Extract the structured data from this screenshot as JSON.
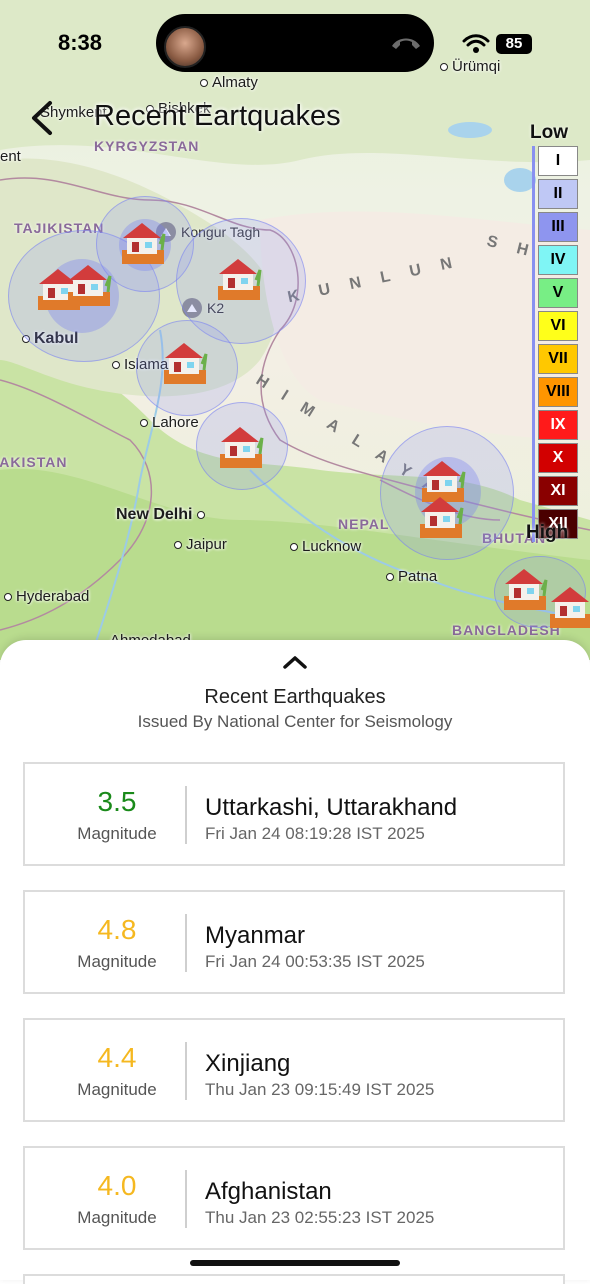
{
  "status_bar": {
    "time": "8:38",
    "battery": "85"
  },
  "header": {
    "title": "Recent Eartquakes"
  },
  "map": {
    "cities": [
      "Almaty",
      "Shymkent",
      "Bishkek",
      "Ürümqi",
      "Kabul",
      "Islamabad",
      "Lahore",
      "New Delhi",
      "Jaipur",
      "Lucknow",
      "Hyderabad",
      "Patna",
      "Ahmedabad"
    ],
    "countries": [
      "KYRGYZSTAN",
      "TAJIKISTAN",
      "PAKISTAN",
      "NEPAL",
      "BHUTAN",
      "BANGLADESH"
    ],
    "peaks": [
      "Kongur Tagh",
      "K2"
    ],
    "ranges": [
      "KUNLUN",
      "HIMALAYA"
    ],
    "partial_labels": [
      "ent",
      "SH"
    ]
  },
  "legend": {
    "low_label": "Low",
    "high_label": "High",
    "levels": [
      {
        "label": "I",
        "color": "#ffffff",
        "text": "#000000"
      },
      {
        "label": "II",
        "color": "#bfc8f5",
        "text": "#000000"
      },
      {
        "label": "III",
        "color": "#8e95ef",
        "text": "#000000"
      },
      {
        "label": "IV",
        "color": "#7ff5f5",
        "text": "#000000"
      },
      {
        "label": "V",
        "color": "#78ee85",
        "text": "#000000"
      },
      {
        "label": "VI",
        "color": "#ffff1a",
        "text": "#000000"
      },
      {
        "label": "VII",
        "color": "#ffc800",
        "text": "#000000"
      },
      {
        "label": "VIII",
        "color": "#ff9500",
        "text": "#000000"
      },
      {
        "label": "IX",
        "color": "#ff1a1a",
        "text": "#ffffff"
      },
      {
        "label": "X",
        "color": "#d20000",
        "text": "#ffffff"
      },
      {
        "label": "XI",
        "color": "#8a0000",
        "text": "#ffffff"
      },
      {
        "label": "XII",
        "color": "#4a0000",
        "text": "#ffffff"
      }
    ]
  },
  "sheet": {
    "title": "Recent Earthquakes",
    "subtitle": "Issued By National Center for Seismology",
    "magnitude_label": "Magnitude",
    "items": [
      {
        "magnitude": "3.5",
        "color": "#1a8a1a",
        "location": "Uttarkashi, Uttarakhand",
        "time": "Fri Jan 24 08:19:28 IST 2025"
      },
      {
        "magnitude": "4.8",
        "color": "#f5b820",
        "location": "Myanmar",
        "time": "Fri Jan 24 00:53:35 IST 2025"
      },
      {
        "magnitude": "4.4",
        "color": "#f5b820",
        "location": "Xinjiang",
        "time": "Thu Jan 23 09:15:49 IST 2025"
      },
      {
        "magnitude": "4.0",
        "color": "#f5b820",
        "location": "Afghanistan",
        "time": "Thu Jan 23 02:55:23 IST 2025"
      }
    ]
  }
}
